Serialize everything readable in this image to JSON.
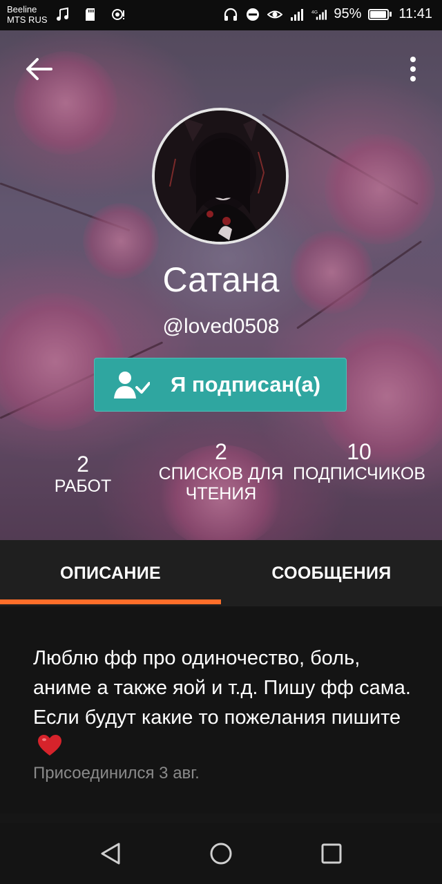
{
  "status_bar": {
    "carrier_line1": "Beeline",
    "carrier_line2": "MTS RUS",
    "network": "4G",
    "battery": "95%",
    "battery_level": 0.95,
    "time": "11:41"
  },
  "profile": {
    "name": "Сатана",
    "handle": "@loved0508",
    "follow_button_label": "Я подписан(а)"
  },
  "stats": {
    "works": {
      "value": "2",
      "label": "РАБОТ"
    },
    "reading_lists": {
      "value": "2",
      "label": "СПИСКОВ ДЛЯ ЧТЕНИЯ"
    },
    "followers": {
      "value": "10",
      "label": "ПОДПИСЧИКОВ"
    }
  },
  "tabs": [
    {
      "label": "ОПИСАНИЕ",
      "active": true
    },
    {
      "label": "СООБЩЕНИЯ",
      "active": false
    }
  ],
  "description": {
    "bio": "Люблю фф про одиночество, боль, аниме а также яой и т.д. Пишу фф сама. Если будут какие то пожелания пишите",
    "bio_emoji": "red-heart-icon",
    "joined": "Присоединился 3 авг."
  },
  "colors": {
    "accent_teal": "#2fa6a0",
    "tab_indicator": "#ff6e2a",
    "background": "#141414"
  }
}
